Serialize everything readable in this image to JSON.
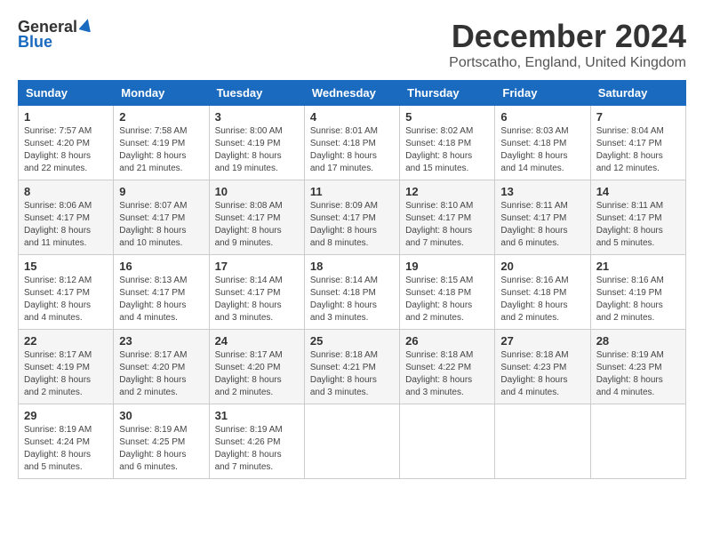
{
  "header": {
    "logo_general": "General",
    "logo_blue": "Blue",
    "month_title": "December 2024",
    "location": "Portscatho, England, United Kingdom"
  },
  "days_of_week": [
    "Sunday",
    "Monday",
    "Tuesday",
    "Wednesday",
    "Thursday",
    "Friday",
    "Saturday"
  ],
  "weeks": [
    [
      {
        "day": "1",
        "sunrise": "7:57 AM",
        "sunset": "4:20 PM",
        "daylight": "8 hours and 22 minutes."
      },
      {
        "day": "2",
        "sunrise": "7:58 AM",
        "sunset": "4:19 PM",
        "daylight": "8 hours and 21 minutes."
      },
      {
        "day": "3",
        "sunrise": "8:00 AM",
        "sunset": "4:19 PM",
        "daylight": "8 hours and 19 minutes."
      },
      {
        "day": "4",
        "sunrise": "8:01 AM",
        "sunset": "4:18 PM",
        "daylight": "8 hours and 17 minutes."
      },
      {
        "day": "5",
        "sunrise": "8:02 AM",
        "sunset": "4:18 PM",
        "daylight": "8 hours and 15 minutes."
      },
      {
        "day": "6",
        "sunrise": "8:03 AM",
        "sunset": "4:18 PM",
        "daylight": "8 hours and 14 minutes."
      },
      {
        "day": "7",
        "sunrise": "8:04 AM",
        "sunset": "4:17 PM",
        "daylight": "8 hours and 12 minutes."
      }
    ],
    [
      {
        "day": "8",
        "sunrise": "8:06 AM",
        "sunset": "4:17 PM",
        "daylight": "8 hours and 11 minutes."
      },
      {
        "day": "9",
        "sunrise": "8:07 AM",
        "sunset": "4:17 PM",
        "daylight": "8 hours and 10 minutes."
      },
      {
        "day": "10",
        "sunrise": "8:08 AM",
        "sunset": "4:17 PM",
        "daylight": "8 hours and 9 minutes."
      },
      {
        "day": "11",
        "sunrise": "8:09 AM",
        "sunset": "4:17 PM",
        "daylight": "8 hours and 8 minutes."
      },
      {
        "day": "12",
        "sunrise": "8:10 AM",
        "sunset": "4:17 PM",
        "daylight": "8 hours and 7 minutes."
      },
      {
        "day": "13",
        "sunrise": "8:11 AM",
        "sunset": "4:17 PM",
        "daylight": "8 hours and 6 minutes."
      },
      {
        "day": "14",
        "sunrise": "8:11 AM",
        "sunset": "4:17 PM",
        "daylight": "8 hours and 5 minutes."
      }
    ],
    [
      {
        "day": "15",
        "sunrise": "8:12 AM",
        "sunset": "4:17 PM",
        "daylight": "8 hours and 4 minutes."
      },
      {
        "day": "16",
        "sunrise": "8:13 AM",
        "sunset": "4:17 PM",
        "daylight": "8 hours and 4 minutes."
      },
      {
        "day": "17",
        "sunrise": "8:14 AM",
        "sunset": "4:17 PM",
        "daylight": "8 hours and 3 minutes."
      },
      {
        "day": "18",
        "sunrise": "8:14 AM",
        "sunset": "4:18 PM",
        "daylight": "8 hours and 3 minutes."
      },
      {
        "day": "19",
        "sunrise": "8:15 AM",
        "sunset": "4:18 PM",
        "daylight": "8 hours and 2 minutes."
      },
      {
        "day": "20",
        "sunrise": "8:16 AM",
        "sunset": "4:18 PM",
        "daylight": "8 hours and 2 minutes."
      },
      {
        "day": "21",
        "sunrise": "8:16 AM",
        "sunset": "4:19 PM",
        "daylight": "8 hours and 2 minutes."
      }
    ],
    [
      {
        "day": "22",
        "sunrise": "8:17 AM",
        "sunset": "4:19 PM",
        "daylight": "8 hours and 2 minutes."
      },
      {
        "day": "23",
        "sunrise": "8:17 AM",
        "sunset": "4:20 PM",
        "daylight": "8 hours and 2 minutes."
      },
      {
        "day": "24",
        "sunrise": "8:17 AM",
        "sunset": "4:20 PM",
        "daylight": "8 hours and 2 minutes."
      },
      {
        "day": "25",
        "sunrise": "8:18 AM",
        "sunset": "4:21 PM",
        "daylight": "8 hours and 3 minutes."
      },
      {
        "day": "26",
        "sunrise": "8:18 AM",
        "sunset": "4:22 PM",
        "daylight": "8 hours and 3 minutes."
      },
      {
        "day": "27",
        "sunrise": "8:18 AM",
        "sunset": "4:23 PM",
        "daylight": "8 hours and 4 minutes."
      },
      {
        "day": "28",
        "sunrise": "8:19 AM",
        "sunset": "4:23 PM",
        "daylight": "8 hours and 4 minutes."
      }
    ],
    [
      {
        "day": "29",
        "sunrise": "8:19 AM",
        "sunset": "4:24 PM",
        "daylight": "8 hours and 5 minutes."
      },
      {
        "day": "30",
        "sunrise": "8:19 AM",
        "sunset": "4:25 PM",
        "daylight": "8 hours and 6 minutes."
      },
      {
        "day": "31",
        "sunrise": "8:19 AM",
        "sunset": "4:26 PM",
        "daylight": "8 hours and 7 minutes."
      },
      null,
      null,
      null,
      null
    ]
  ],
  "labels": {
    "sunrise": "Sunrise:",
    "sunset": "Sunset:",
    "daylight": "Daylight:"
  }
}
